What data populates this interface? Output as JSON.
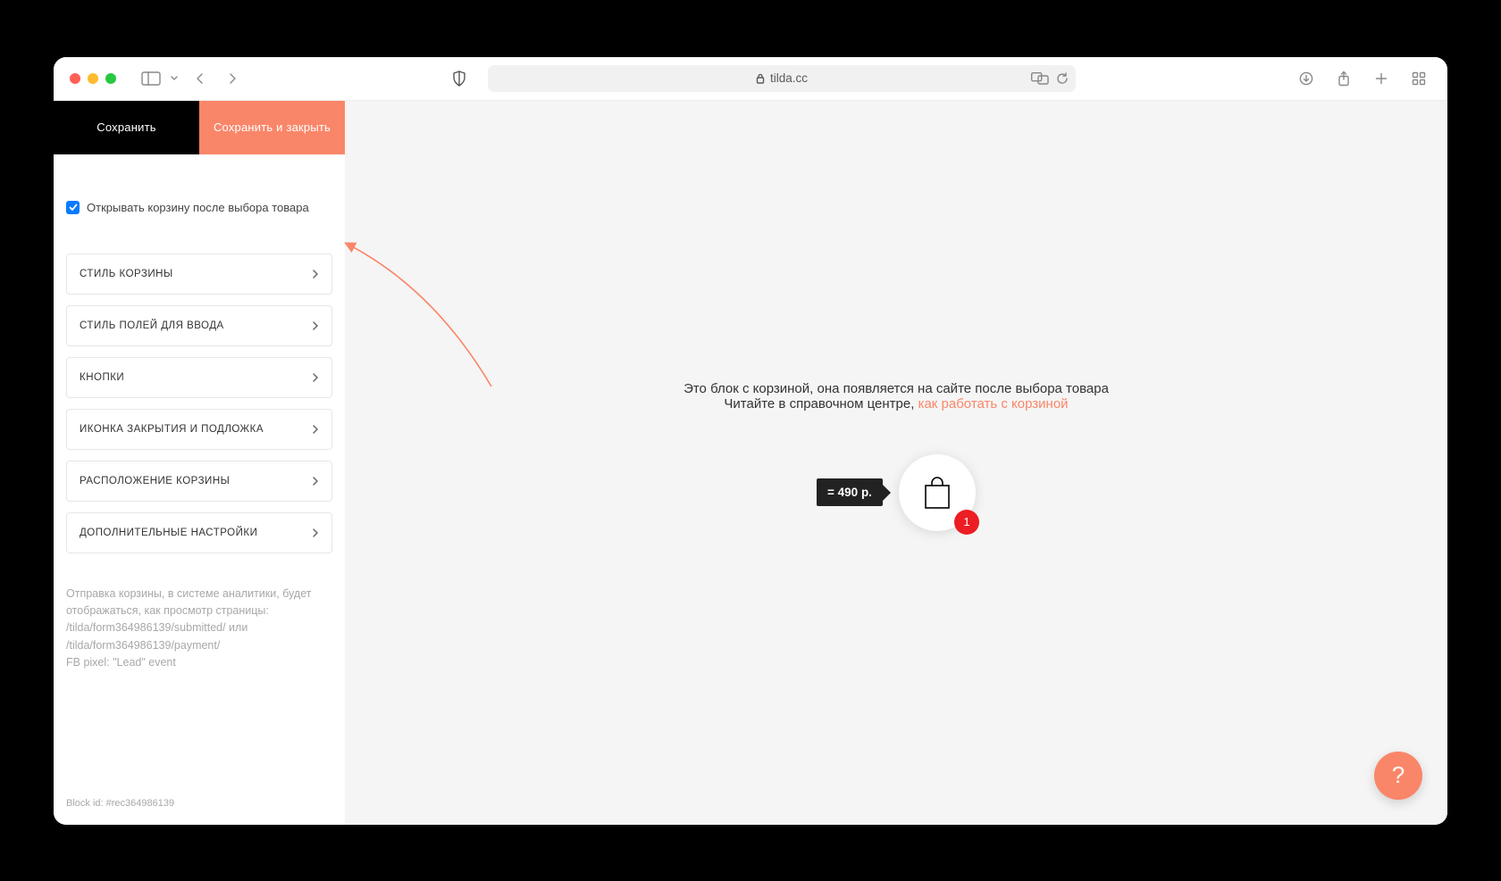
{
  "browser": {
    "url_host": "tilda.cc"
  },
  "sidebar": {
    "save_label": "Сохранить",
    "save_close_label": "Сохранить и закрыть",
    "checkbox_label": "Открывать корзину после выбора товара",
    "checkbox_checked": true,
    "sections": [
      "СТИЛЬ КОРЗИНЫ",
      "СТИЛЬ ПОЛЕЙ ДЛЯ ВВОДА",
      "КНОПКИ",
      "ИКОНКА ЗАКРЫТИЯ И ПОДЛОЖКА",
      "РАСПОЛОЖЕНИЕ КОРЗИНЫ",
      "ДОПОЛНИТЕЛЬНЫЕ НАСТРОЙКИ"
    ],
    "help_text": "Отправка корзины, в системе аналитики, будет отображаться, как просмотр страницы: /tilda/form364986139/submitted/ или /tilda/form364986139/payment/\nFB pixel: \"Lead\" event",
    "block_id_label": "Block id: #rec364986139"
  },
  "preview": {
    "hint_line1": "Это блок с корзиной, она появляется на сайте после выбора товара",
    "hint_line2_prefix": "Читайте в справочном центре, ",
    "hint_link": "как работать с корзиной",
    "price_label": "= 490 р.",
    "badge_count": "1"
  },
  "fab": {
    "label": "?"
  },
  "colors": {
    "accent": "#fa8669",
    "badge": "#ec1d23"
  }
}
